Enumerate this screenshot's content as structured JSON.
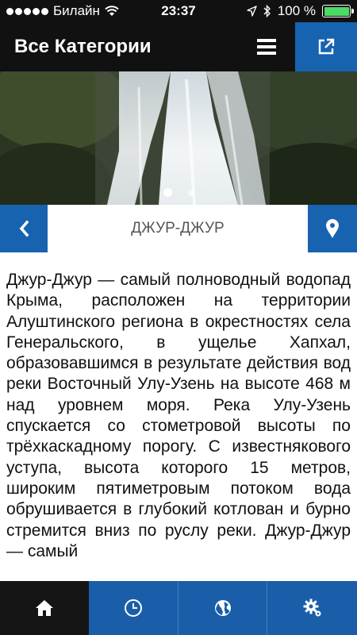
{
  "status_bar": {
    "carrier": "Билайн",
    "time": "23:37",
    "battery": "100 %",
    "battery_level": 1.0,
    "icons": [
      "signal-dots-icon",
      "wifi-icon",
      "location-arrow-icon",
      "bluetooth-icon",
      "battery-icon"
    ]
  },
  "header": {
    "title": "Все Категории",
    "menu_icon": "hamburger-menu-icon",
    "share_icon": "share-icon"
  },
  "gallery": {
    "slide_count": 2,
    "active_slide": 1
  },
  "place": {
    "title": "ДЖУР-ДЖУР",
    "back_icon": "chevron-left-icon",
    "map_icon": "map-pin-icon"
  },
  "description": "Джур-Джур — самый полноводный водопад Крыма, расположен на территории Алуштинского региона в окрестностях села Генеральского, в ущелье Хапхал, образовавшимся в результате действия вод реки Восточный Улу-Узень на высоте 468 м над уровнем моря. Река Улу-Узень спускается со стометровой высоты по трёхкаскадному порогу. С известнякового уступа, высота которого 15 метров, широким пятиметровым потоком вода обрушивается в глубокий котлован и бурно стремится вниз по руслу реки. Джур-Джур — самый",
  "tabbar": {
    "tabs": [
      {
        "icon": "home-icon",
        "active": true
      },
      {
        "icon": "clock-icon",
        "active": false
      },
      {
        "icon": "globe-icon",
        "active": false
      },
      {
        "icon": "settings-gear-icon",
        "active": false
      }
    ]
  },
  "colors": {
    "header_bg": "#111111",
    "accent_blue": "#1763b0",
    "tab_blue": "#1a5ea9",
    "tab_active": "#151515"
  }
}
